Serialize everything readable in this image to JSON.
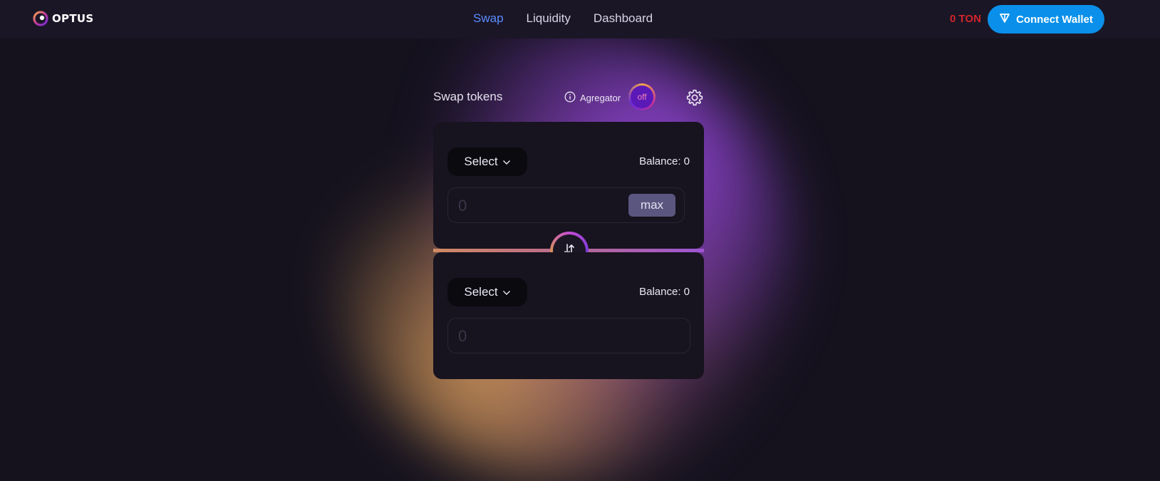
{
  "header": {
    "logo_text": "OPTUS",
    "nav": [
      {
        "label": "Swap",
        "active": true
      },
      {
        "label": "Liquidity",
        "active": false
      },
      {
        "label": "Dashboard",
        "active": false
      }
    ],
    "ton_balance": "0 TON",
    "connect_wallet_label": "Connect Wallet"
  },
  "swap": {
    "title": "Swap tokens",
    "aggregator_label": "Agregator",
    "aggregator_toggle": "off",
    "from": {
      "select_label": "Select",
      "balance": "Balance: 0",
      "amount": "0",
      "max_label": "max"
    },
    "to": {
      "select_label": "Select",
      "balance": "Balance: 0",
      "amount": "0"
    }
  },
  "colors": {
    "active_nav": "#5b8cff",
    "ton_balance": "#d3242b",
    "connect_button": "#0a90ea",
    "background": "#15121e"
  },
  "icons": [
    "optus-logo-icon",
    "ton-diamond-icon",
    "info-icon",
    "gear-icon",
    "chevron-down-icon",
    "swap-arrows-icon"
  ]
}
